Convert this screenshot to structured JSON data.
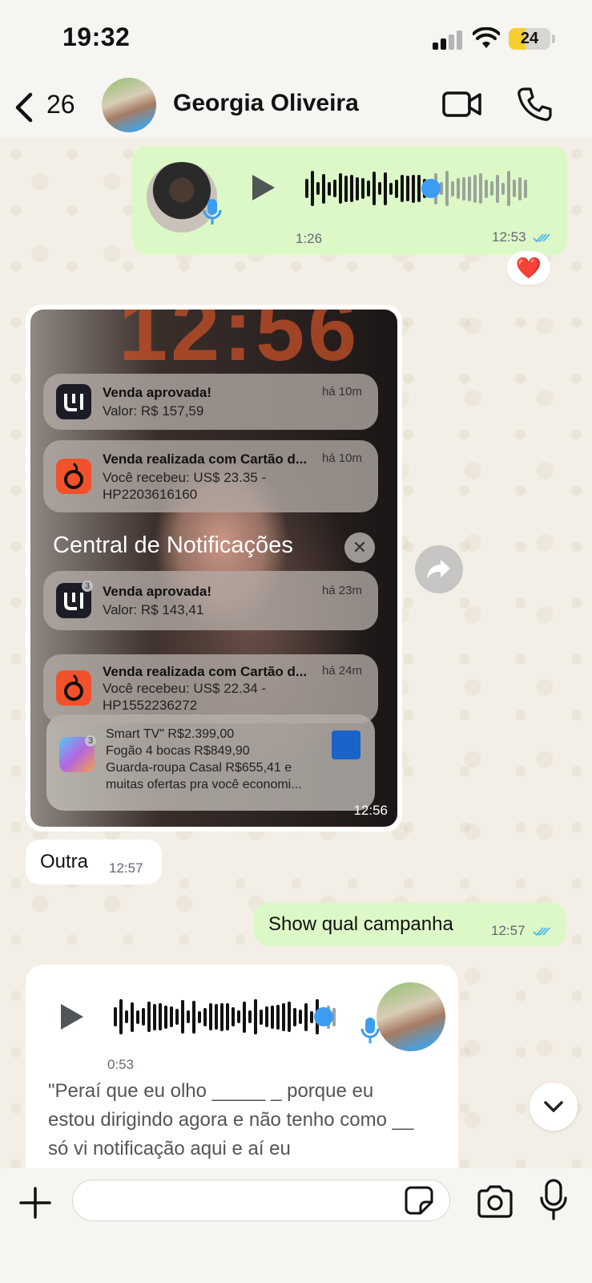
{
  "status": {
    "time": "19:32",
    "battery": "24"
  },
  "header": {
    "back_count": "26",
    "contact_name": "Georgia Oliveira"
  },
  "messages": {
    "voice_out": {
      "duration": "1:26",
      "time": "12:53",
      "reaction": "❤️"
    },
    "image": {
      "clock": "12:56",
      "notifications_top": [
        {
          "title": "Venda aprovada!",
          "body": "Valor: R$ 157,59",
          "ago": "há 10m"
        },
        {
          "title": "Venda realizada com Cartão d...",
          "body": "Você recebeu: US$ 23.35 -\nHP2203616160",
          "ago": "há 10m"
        }
      ],
      "center_title": "Central de Notificações",
      "close_glyph": "✕",
      "notifications_center": [
        {
          "title": "Venda aprovada!",
          "body": "Valor: R$ 143,41",
          "ago": "há 23m",
          "badge": "3"
        },
        {
          "title": "Venda realizada com Cartão d...",
          "body": "Você recebeu: US$ 22.34 -\nHP1552236272",
          "ago": "há 24m"
        },
        {
          "title": "",
          "body": "Smart TV\" R$2.399,00\nFogão 4 bocas R$849,90\nGuarda-roupa Casal R$655,41 e\nmuitas ofertas pra você economi...",
          "ago": "",
          "badge": "3"
        }
      ],
      "time": "12:56"
    },
    "outra": {
      "text": "Outra",
      "time": "12:57"
    },
    "show": {
      "text": "Show qual campanha",
      "time": "12:57"
    },
    "voice_in": {
      "duration": "0:53",
      "transcript": "\"Peraí que eu olho _____ _ porque eu estou dirigindo agora e não tenho como __ só vi notificação aqui e aí eu"
    }
  },
  "colors": {
    "outgoing": "#dcf8c6",
    "incoming": "#ffffff",
    "accent_blue": "#3c9cf2",
    "read_ticks": "#53bdeb",
    "heart": "#e0202e"
  }
}
